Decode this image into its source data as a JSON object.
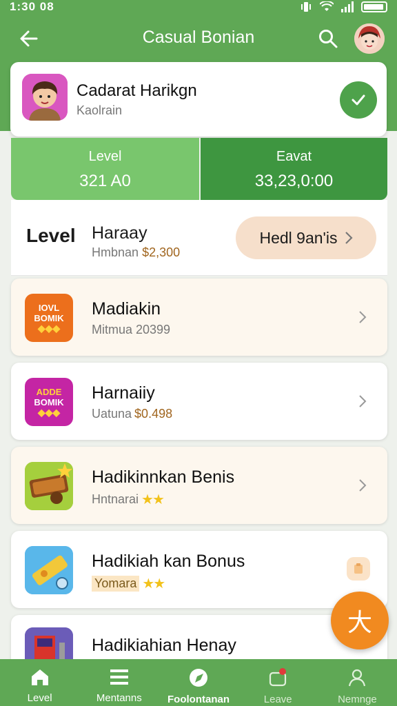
{
  "status_bar": {
    "time": "1:30 08"
  },
  "app_bar": {
    "title": "Casual Bonian"
  },
  "profile": {
    "name": "Cadarat Harikgn",
    "subtitle": "Kaolrain"
  },
  "stats": {
    "left": {
      "label": "Level",
      "value": "321 A0"
    },
    "right": {
      "label": "Eavat",
      "value": "33,23,0:00"
    }
  },
  "level_row": {
    "label": "Level",
    "title": "Haraay",
    "sub_prefix": "Hmbnan",
    "sub_amount": "$2,300",
    "button_label": "Hedl 9an'is"
  },
  "items": [
    {
      "title": "Madiakin",
      "sub": "Mitmua 20399",
      "icon_line1": "IOVL",
      "icon_line2": "BOMIK",
      "icon_color": "#ec6f1c"
    },
    {
      "title": "Harnaiiy",
      "sub_prefix": "Uatuna",
      "sub_amount": "$0.498",
      "icon_line1": "ADDE",
      "icon_line2": "BOMIK",
      "icon_color": "#c425a4"
    },
    {
      "title": "Hadikinnkan Benis",
      "sub": "Hntnarai",
      "icon_color": "#a5cf3d"
    },
    {
      "title": "Hadikiah kan Bonus",
      "sub": "Yomara",
      "icon_color": "#59b7ea"
    },
    {
      "title": "Hadikiahian Henay",
      "icon_color": "#6b5cb8"
    }
  ],
  "fab": {
    "label": "大"
  },
  "bottom_nav": [
    {
      "label": "Level",
      "icon": "home-icon"
    },
    {
      "label": "Mentanns",
      "icon": "menu-icon"
    },
    {
      "label": "Foolontanan",
      "icon": "compass-icon"
    },
    {
      "label": "Leave",
      "icon": "bag-icon"
    },
    {
      "label": "Nemnge",
      "icon": "person-icon"
    }
  ],
  "colors": {
    "primary_green": "#5fa855",
    "dark_green": "#3e9640",
    "light_green": "#79c66d",
    "fab_orange": "#f18a20"
  }
}
